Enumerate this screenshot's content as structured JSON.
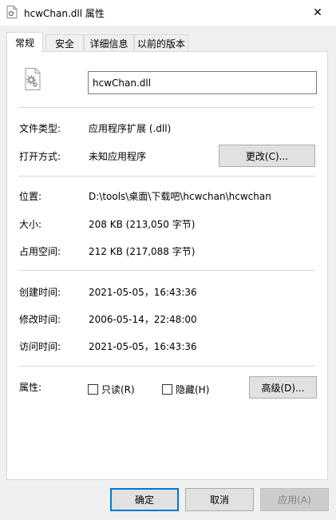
{
  "window": {
    "title": "hcwChan.dll 属性",
    "close_glyph": "✕"
  },
  "tabs": [
    {
      "label": "常规"
    },
    {
      "label": "安全"
    },
    {
      "label": "详细信息"
    },
    {
      "label": "以前的版本"
    }
  ],
  "general": {
    "file_name": "hcwChan.dll",
    "file_type": {
      "label": "文件类型:",
      "value": "应用程序扩展 (.dll)"
    },
    "opens_with": {
      "label": "打开方式:",
      "value": "未知应用程序",
      "change_button": "更改(C)..."
    },
    "location": {
      "label": "位置:",
      "value": "D:\\tools\\桌面\\下载吧\\hcwchan\\hcwchan"
    },
    "size": {
      "label": "大小:",
      "value": "208 KB (213,050 字节)"
    },
    "size_on_disk": {
      "label": "占用空间:",
      "value": "212 KB (217,088 字节)"
    },
    "created": {
      "label": "创建时间:",
      "value": "2021-05-05，16:43:36"
    },
    "modified": {
      "label": "修改时间:",
      "value": "2006-05-14，22:48:00"
    },
    "accessed": {
      "label": "访问时间:",
      "value": "2021-05-05，16:43:36"
    },
    "attributes": {
      "label": "属性:",
      "readonly": {
        "label": "只读(R)",
        "checked": false
      },
      "hidden": {
        "label": "隐藏(H)",
        "checked": false
      },
      "advanced_button": "高级(D)..."
    }
  },
  "footer": {
    "ok": "确定",
    "cancel": "取消",
    "apply": "应用(A)"
  }
}
